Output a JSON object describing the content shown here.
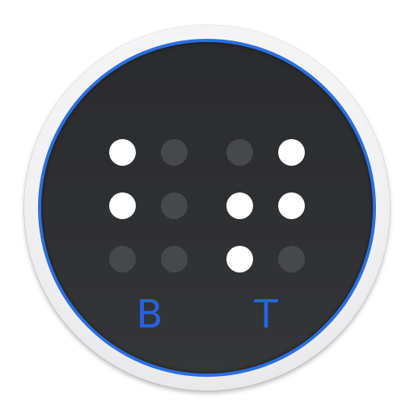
{
  "icon": {
    "colors": {
      "ring": "#f0f0f2",
      "accent_ring": "#2b6fe0",
      "face": "#2f3032",
      "dot_on": "#ffffff",
      "dot_off": "#47484a",
      "letter": "#2563e6"
    },
    "cells": [
      {
        "letter": "B",
        "dots": [
          [
            true,
            false
          ],
          [
            true,
            false
          ],
          [
            false,
            false
          ]
        ]
      },
      {
        "letter": "T",
        "dots": [
          [
            false,
            true
          ],
          [
            true,
            true
          ],
          [
            true,
            false
          ]
        ]
      }
    ]
  }
}
